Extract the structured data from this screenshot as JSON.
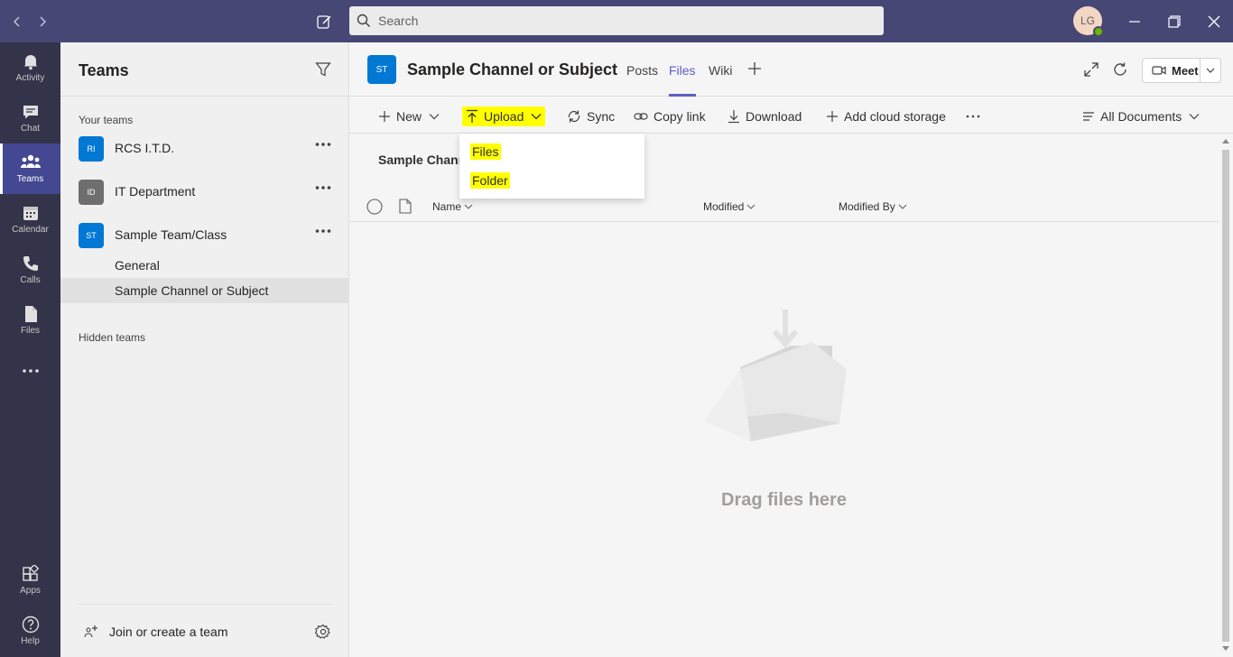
{
  "titlebar": {
    "search_placeholder": "Search",
    "avatar_initials": "LG"
  },
  "rail": {
    "items": [
      {
        "label": "Activity"
      },
      {
        "label": "Chat"
      },
      {
        "label": "Teams"
      },
      {
        "label": "Calendar"
      },
      {
        "label": "Calls"
      },
      {
        "label": "Files"
      },
      {
        "label": "Apps"
      },
      {
        "label": "Help"
      }
    ]
  },
  "teams_panel": {
    "title": "Teams",
    "your_teams_label": "Your teams",
    "hidden_teams_label": "Hidden teams",
    "teams": [
      {
        "initials": "RI",
        "name": "RCS I.T.D.",
        "color": "#0078d4"
      },
      {
        "initials": "ID",
        "name": "IT Department",
        "color": "#6e6e6e"
      },
      {
        "initials": "ST",
        "name": "Sample Team/Class",
        "color": "#0078d4"
      }
    ],
    "channels": [
      {
        "name": "General"
      },
      {
        "name": "Sample Channel or Subject"
      }
    ],
    "join_label": "Join or create a team"
  },
  "channel": {
    "initials": "ST",
    "title": "Sample Channel or Subject",
    "tabs": [
      {
        "label": "Posts"
      },
      {
        "label": "Files"
      },
      {
        "label": "Wiki"
      }
    ],
    "meet_label": "Meet"
  },
  "toolbar": {
    "new_label": "New",
    "upload_label": "Upload",
    "sync_label": "Sync",
    "copy_link_label": "Copy link",
    "download_label": "Download",
    "add_cloud_label": "Add cloud storage",
    "view_label": "All Documents"
  },
  "upload_menu": {
    "items": [
      {
        "label": "Files"
      },
      {
        "label": "Folder"
      }
    ]
  },
  "files": {
    "breadcrumb": "Sample Chann",
    "columns": {
      "name": "Name",
      "modified": "Modified",
      "modified_by": "Modified By"
    },
    "empty_text": "Drag files here"
  },
  "colors": {
    "titlebar": "#464775",
    "rail": "#33344a",
    "accent": "#5b5fc7",
    "highlight": "#ffff00"
  }
}
